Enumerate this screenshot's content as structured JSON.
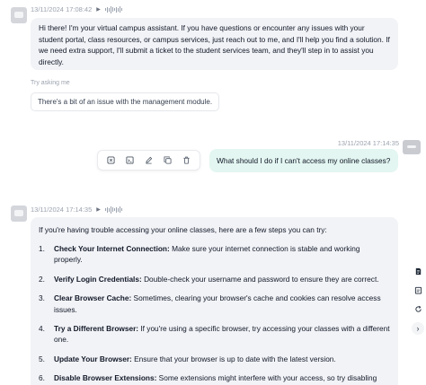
{
  "messages": {
    "first": {
      "timestamp": "13/11/2024 17:08:42",
      "text": "Hi there! I'm your virtual campus assistant. If you have questions or encounter any issues with your student portal, class resources, or campus services, just reach out to me, and I'll help you find a solution. If we need extra support, I'll submit a ticket to the student services team, and they'll step in to assist you directly."
    },
    "try_asking": {
      "label": "Try asking me",
      "suggestion": "There's a bit of an issue with the management module."
    },
    "user": {
      "timestamp": "13/11/2024 17:14:35",
      "text": "What should I do if I can't access my online classes?"
    },
    "second": {
      "timestamp": "13/11/2024 17:14:35",
      "intro": "If you're having trouble accessing your online classes, here are a few steps you can try:",
      "steps": [
        {
          "num": "1.",
          "title": "Check Your Internet Connection:",
          "text": "Make sure your internet connection is stable and working properly."
        },
        {
          "num": "2.",
          "title": "Verify Login Credentials:",
          "text": "Double-check your username and password to ensure they are correct."
        },
        {
          "num": "3.",
          "title": "Clear Browser Cache:",
          "text": "Sometimes, clearing your browser's cache and cookies can resolve access issues."
        },
        {
          "num": "4.",
          "title": "Try a Different Browser:",
          "text": "If you're using a specific browser, try accessing your classes with a different one."
        },
        {
          "num": "5.",
          "title": "Update Your Browser:",
          "text": "Ensure that your browser is up to date with the latest version."
        },
        {
          "num": "6.",
          "title": "Disable Browser Extensions:",
          "text": "Some extensions might interfere with your access, so try disabling them temporarily."
        }
      ]
    }
  },
  "icons": {
    "play": "play-icon",
    "waveform": "waveform-icon",
    "actions": [
      "stop-icon",
      "console-icon",
      "edit-icon",
      "copy-icon",
      "delete-icon"
    ],
    "rail": [
      "document-icon",
      "clipboard-icon",
      "refresh-icon",
      "chevron-right-icon"
    ]
  },
  "colors": {
    "assistant_bubble": "#f2f3f7",
    "user_bubble": "#e3f6f1",
    "meta_text": "#9ca3af"
  }
}
